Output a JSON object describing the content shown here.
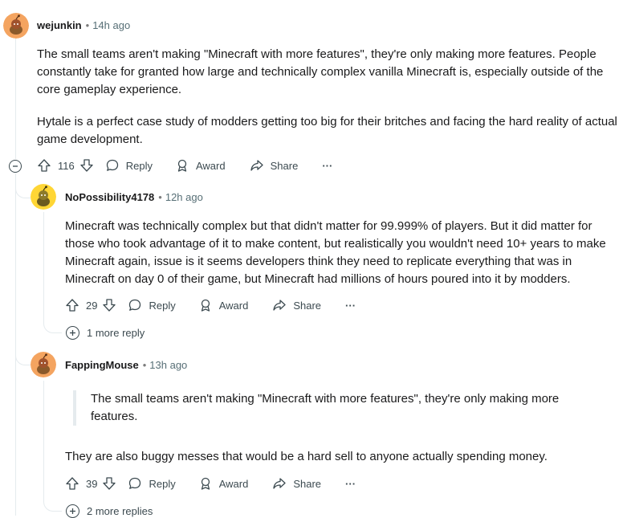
{
  "comments": [
    {
      "author": "wejunkin",
      "time": "14h ago",
      "paragraphs": [
        "The small teams aren't making \"Minecraft with more features\", they're only making more features. People constantly take for granted how large and technically complex vanilla Minecraft is, especially outside of the core gameplay experience.",
        "Hytale is a perfect case study of modders getting too big for their britches and facing the hard reality of actual game development."
      ],
      "votes": "116"
    },
    {
      "author": "NoPossibility4178",
      "time": "12h ago",
      "paragraphs": [
        "Minecraft was technically complex but that didn't matter for 99.999% of players. But it did matter for those who took advantage of it to make content, but realistically you wouldn't need 10+ years to make Minecraft again, issue is it seems developers think they need to replicate everything that was in Minecraft on day 0 of their game, but Minecraft had millions of hours poured into it by modders."
      ],
      "votes": "29",
      "more_replies": "1 more reply"
    },
    {
      "author": "FappingMouse",
      "time": "13h ago",
      "quote": "The small teams aren't making \"Minecraft with more features\", they're only making more features.",
      "paragraphs": [
        "They are also buggy messes that would be a hard sell to anyone actually spending money."
      ],
      "votes": "39",
      "more_replies": "2 more replies"
    }
  ],
  "actions": {
    "reply": "Reply",
    "award": "Award",
    "share": "Share",
    "more": "···"
  },
  "separator": "•",
  "colors": {
    "text": "#1a1a1b",
    "meta": "#576f76",
    "thread_line": "#e5ebee",
    "avatar_orange": "#f4a460",
    "avatar_yellow": "#ffd635"
  }
}
